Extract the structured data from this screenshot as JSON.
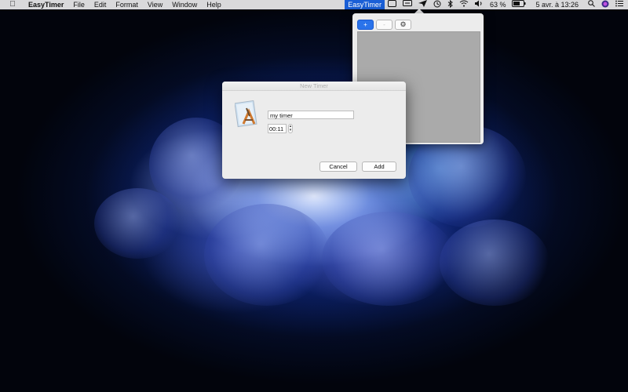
{
  "menubar": {
    "app_name": "EasyTimer",
    "menus": [
      "File",
      "Edit",
      "Format",
      "View",
      "Window",
      "Help"
    ],
    "status_app_label": "EasyTimer",
    "battery_text": "63 %",
    "datetime": "5 avr. à 13:26"
  },
  "popover": {
    "add_label": "+",
    "remove_label": "-",
    "settings_label": "⚙"
  },
  "dialog": {
    "title": "New Timer",
    "name_value": "my timer",
    "time_value": "00:11",
    "cancel_label": "Cancel",
    "add_label": "Add"
  },
  "colors": {
    "accent": "#1a5fd6",
    "popover_list_bg": "#aaaaaa",
    "window_bg": "#ececec"
  }
}
